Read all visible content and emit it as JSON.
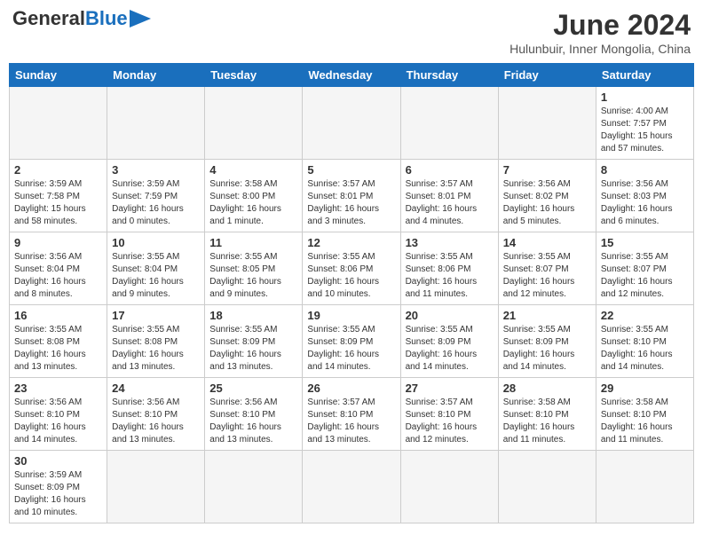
{
  "header": {
    "logo_general": "General",
    "logo_blue": "Blue",
    "title": "June 2024",
    "subtitle": "Hulunbuir, Inner Mongolia, China"
  },
  "weekdays": [
    "Sunday",
    "Monday",
    "Tuesday",
    "Wednesday",
    "Thursday",
    "Friday",
    "Saturday"
  ],
  "weeks": [
    [
      {
        "day": "",
        "info": ""
      },
      {
        "day": "",
        "info": ""
      },
      {
        "day": "",
        "info": ""
      },
      {
        "day": "",
        "info": ""
      },
      {
        "day": "",
        "info": ""
      },
      {
        "day": "",
        "info": ""
      },
      {
        "day": "1",
        "info": "Sunrise: 4:00 AM\nSunset: 7:57 PM\nDaylight: 15 hours\nand 57 minutes."
      }
    ],
    [
      {
        "day": "2",
        "info": "Sunrise: 3:59 AM\nSunset: 7:58 PM\nDaylight: 15 hours\nand 58 minutes."
      },
      {
        "day": "3",
        "info": "Sunrise: 3:59 AM\nSunset: 7:59 PM\nDaylight: 16 hours\nand 0 minutes."
      },
      {
        "day": "4",
        "info": "Sunrise: 3:58 AM\nSunset: 8:00 PM\nDaylight: 16 hours\nand 1 minute."
      },
      {
        "day": "5",
        "info": "Sunrise: 3:57 AM\nSunset: 8:01 PM\nDaylight: 16 hours\nand 3 minutes."
      },
      {
        "day": "6",
        "info": "Sunrise: 3:57 AM\nSunset: 8:01 PM\nDaylight: 16 hours\nand 4 minutes."
      },
      {
        "day": "7",
        "info": "Sunrise: 3:56 AM\nSunset: 8:02 PM\nDaylight: 16 hours\nand 5 minutes."
      },
      {
        "day": "8",
        "info": "Sunrise: 3:56 AM\nSunset: 8:03 PM\nDaylight: 16 hours\nand 6 minutes."
      }
    ],
    [
      {
        "day": "9",
        "info": "Sunrise: 3:56 AM\nSunset: 8:04 PM\nDaylight: 16 hours\nand 8 minutes."
      },
      {
        "day": "10",
        "info": "Sunrise: 3:55 AM\nSunset: 8:04 PM\nDaylight: 16 hours\nand 9 minutes."
      },
      {
        "day": "11",
        "info": "Sunrise: 3:55 AM\nSunset: 8:05 PM\nDaylight: 16 hours\nand 9 minutes."
      },
      {
        "day": "12",
        "info": "Sunrise: 3:55 AM\nSunset: 8:06 PM\nDaylight: 16 hours\nand 10 minutes."
      },
      {
        "day": "13",
        "info": "Sunrise: 3:55 AM\nSunset: 8:06 PM\nDaylight: 16 hours\nand 11 minutes."
      },
      {
        "day": "14",
        "info": "Sunrise: 3:55 AM\nSunset: 8:07 PM\nDaylight: 16 hours\nand 12 minutes."
      },
      {
        "day": "15",
        "info": "Sunrise: 3:55 AM\nSunset: 8:07 PM\nDaylight: 16 hours\nand 12 minutes."
      }
    ],
    [
      {
        "day": "16",
        "info": "Sunrise: 3:55 AM\nSunset: 8:08 PM\nDaylight: 16 hours\nand 13 minutes."
      },
      {
        "day": "17",
        "info": "Sunrise: 3:55 AM\nSunset: 8:08 PM\nDaylight: 16 hours\nand 13 minutes."
      },
      {
        "day": "18",
        "info": "Sunrise: 3:55 AM\nSunset: 8:09 PM\nDaylight: 16 hours\nand 13 minutes."
      },
      {
        "day": "19",
        "info": "Sunrise: 3:55 AM\nSunset: 8:09 PM\nDaylight: 16 hours\nand 14 minutes."
      },
      {
        "day": "20",
        "info": "Sunrise: 3:55 AM\nSunset: 8:09 PM\nDaylight: 16 hours\nand 14 minutes."
      },
      {
        "day": "21",
        "info": "Sunrise: 3:55 AM\nSunset: 8:09 PM\nDaylight: 16 hours\nand 14 minutes."
      },
      {
        "day": "22",
        "info": "Sunrise: 3:55 AM\nSunset: 8:10 PM\nDaylight: 16 hours\nand 14 minutes."
      }
    ],
    [
      {
        "day": "23",
        "info": "Sunrise: 3:56 AM\nSunset: 8:10 PM\nDaylight: 16 hours\nand 14 minutes."
      },
      {
        "day": "24",
        "info": "Sunrise: 3:56 AM\nSunset: 8:10 PM\nDaylight: 16 hours\nand 13 minutes."
      },
      {
        "day": "25",
        "info": "Sunrise: 3:56 AM\nSunset: 8:10 PM\nDaylight: 16 hours\nand 13 minutes."
      },
      {
        "day": "26",
        "info": "Sunrise: 3:57 AM\nSunset: 8:10 PM\nDaylight: 16 hours\nand 13 minutes."
      },
      {
        "day": "27",
        "info": "Sunrise: 3:57 AM\nSunset: 8:10 PM\nDaylight: 16 hours\nand 12 minutes."
      },
      {
        "day": "28",
        "info": "Sunrise: 3:58 AM\nSunset: 8:10 PM\nDaylight: 16 hours\nand 11 minutes."
      },
      {
        "day": "29",
        "info": "Sunrise: 3:58 AM\nSunset: 8:10 PM\nDaylight: 16 hours\nand 11 minutes."
      }
    ],
    [
      {
        "day": "30",
        "info": "Sunrise: 3:59 AM\nSunset: 8:09 PM\nDaylight: 16 hours\nand 10 minutes."
      },
      {
        "day": "",
        "info": ""
      },
      {
        "day": "",
        "info": ""
      },
      {
        "day": "",
        "info": ""
      },
      {
        "day": "",
        "info": ""
      },
      {
        "day": "",
        "info": ""
      },
      {
        "day": "",
        "info": ""
      }
    ]
  ]
}
